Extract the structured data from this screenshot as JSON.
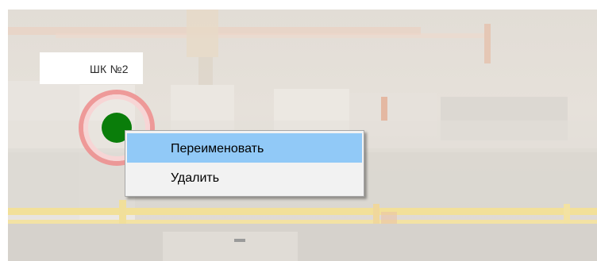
{
  "marker": {
    "label": "ШК №2",
    "status_color": "#0a7d0a",
    "ring_color": "#ee8c8c"
  },
  "context_menu": {
    "items": [
      {
        "label": "Переименовать",
        "highlighted": true
      },
      {
        "label": "Удалить",
        "highlighted": false
      }
    ],
    "highlight_color": "#91c9f7"
  }
}
